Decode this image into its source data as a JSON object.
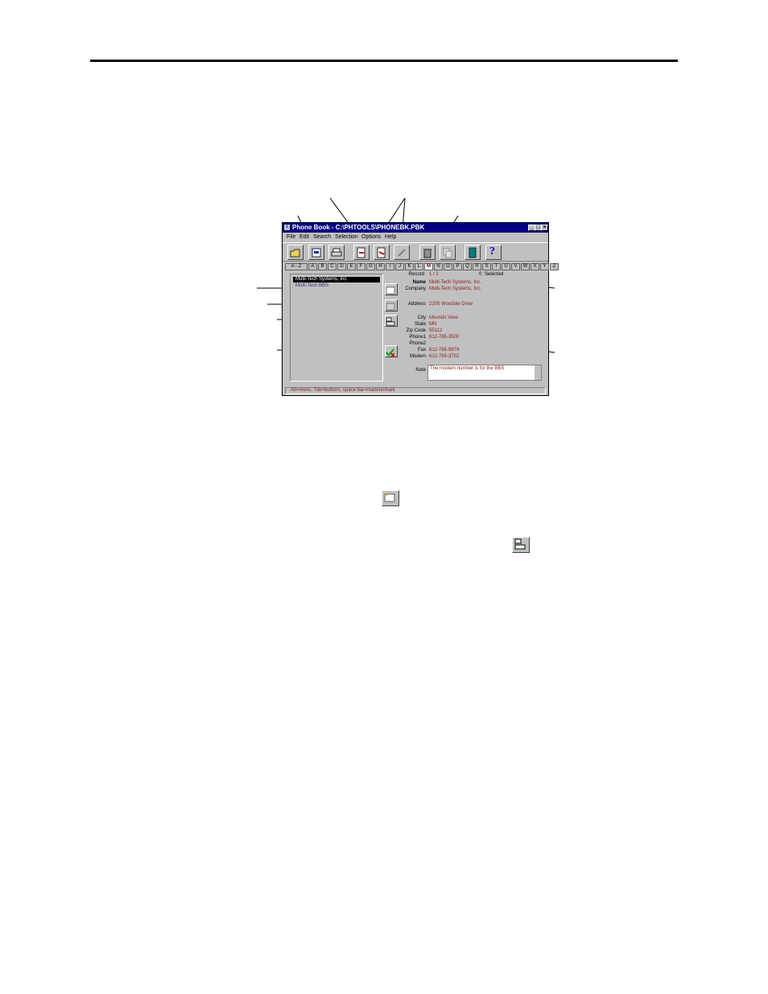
{
  "window": {
    "title": "Phone Book - C:\\PHTOOLS\\PHONEBK.PBK",
    "menu": [
      "File",
      "Edit",
      "Search",
      "Selection",
      "Options",
      "Help"
    ]
  },
  "toolbar": {
    "icons": [
      "open-folder-icon",
      "new-record-icon",
      "print-icon",
      "import-icon",
      "export-icon",
      "edit-icon",
      "trash-icon",
      "copy-icon",
      "exit-door-icon",
      "help-icon"
    ],
    "help_glyph": "?"
  },
  "tabs": [
    "A - Z",
    "A",
    "B",
    "C",
    "D",
    "E",
    "F",
    "G",
    "H",
    "I",
    "J",
    "K",
    "L",
    "M",
    "N",
    "O",
    "P",
    "Q",
    "R",
    "S",
    "T",
    "U",
    "V",
    "W",
    "X",
    "Y",
    "Z"
  ],
  "active_tab": "M",
  "list": {
    "items": [
      "Multi-Tech Systems, Inc.",
      "Multi-Tech BBS"
    ],
    "selected_index": 0
  },
  "record": {
    "record_label": "Record",
    "record_value": "1 / 2",
    "selected_count": "0",
    "selected_label": "Selected",
    "fields": [
      {
        "label": "Name",
        "value": "Multi-Tech Systems, Inc."
      },
      {
        "label": "Company",
        "value": "Multi-Tech Systems, Inc."
      },
      {
        "label": "Address",
        "value": "2205 Woodale Drive"
      },
      {
        "label": "City",
        "value": "Mounds View"
      },
      {
        "label": "State",
        "value": "MN"
      },
      {
        "label": "Zip Code",
        "value": "55112"
      },
      {
        "label": "Phone1",
        "value": "612-785-3500"
      },
      {
        "label": "Phone2",
        "value": ""
      },
      {
        "label": "Fax",
        "value": "612-785-9874"
      },
      {
        "label": "Modem",
        "value": "612-785-3702"
      }
    ],
    "note_label": "Note",
    "note_value": "The modem number is for the BBS"
  },
  "status": "Alt=menu, Tab=buttons, space bar=mark/unmark"
}
